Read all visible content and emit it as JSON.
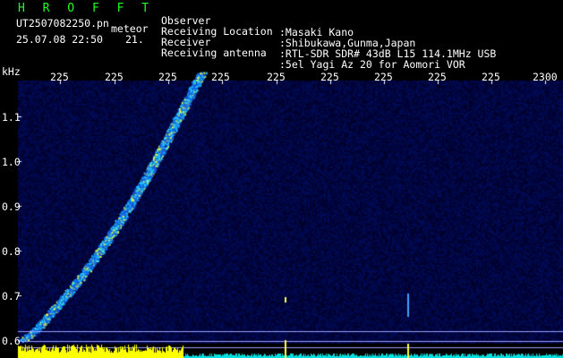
{
  "header": {
    "app_title": "H R O F F T",
    "file_name": "UT2507082250.pn",
    "meteor_label": "meteor",
    "datetime": "25.07.08 22:50",
    "counter": "21."
  },
  "meta": [
    {
      "label": "Observer",
      "value": ":Masaki Kano"
    },
    {
      "label": "Receiving Location",
      "value": ":Shibukawa,Gunma,Japan"
    },
    {
      "label": "Receiver",
      "value": ":RTL-SDR SDR# 43dB L15 114.1MHz USB"
    },
    {
      "label": "Receiving antenna",
      "value": ":5el Yagi Az 20 for Aomori VOR"
    }
  ],
  "axes": {
    "y_unit": "kHz",
    "y_ticks": [
      "1.1",
      "1.0",
      "0.9",
      "0.8",
      "0.7",
      "0.6"
    ],
    "x_ticks": [
      "225",
      "225",
      "225",
      "225",
      "225",
      "225",
      "225",
      "225",
      "225",
      "2300"
    ]
  },
  "colors": {
    "background": "#000000",
    "text": "#ffffff",
    "title": "#20ff20",
    "trace": "#2aa8ff",
    "baseline": "#00e0e0",
    "noise": "#ffff00"
  }
}
